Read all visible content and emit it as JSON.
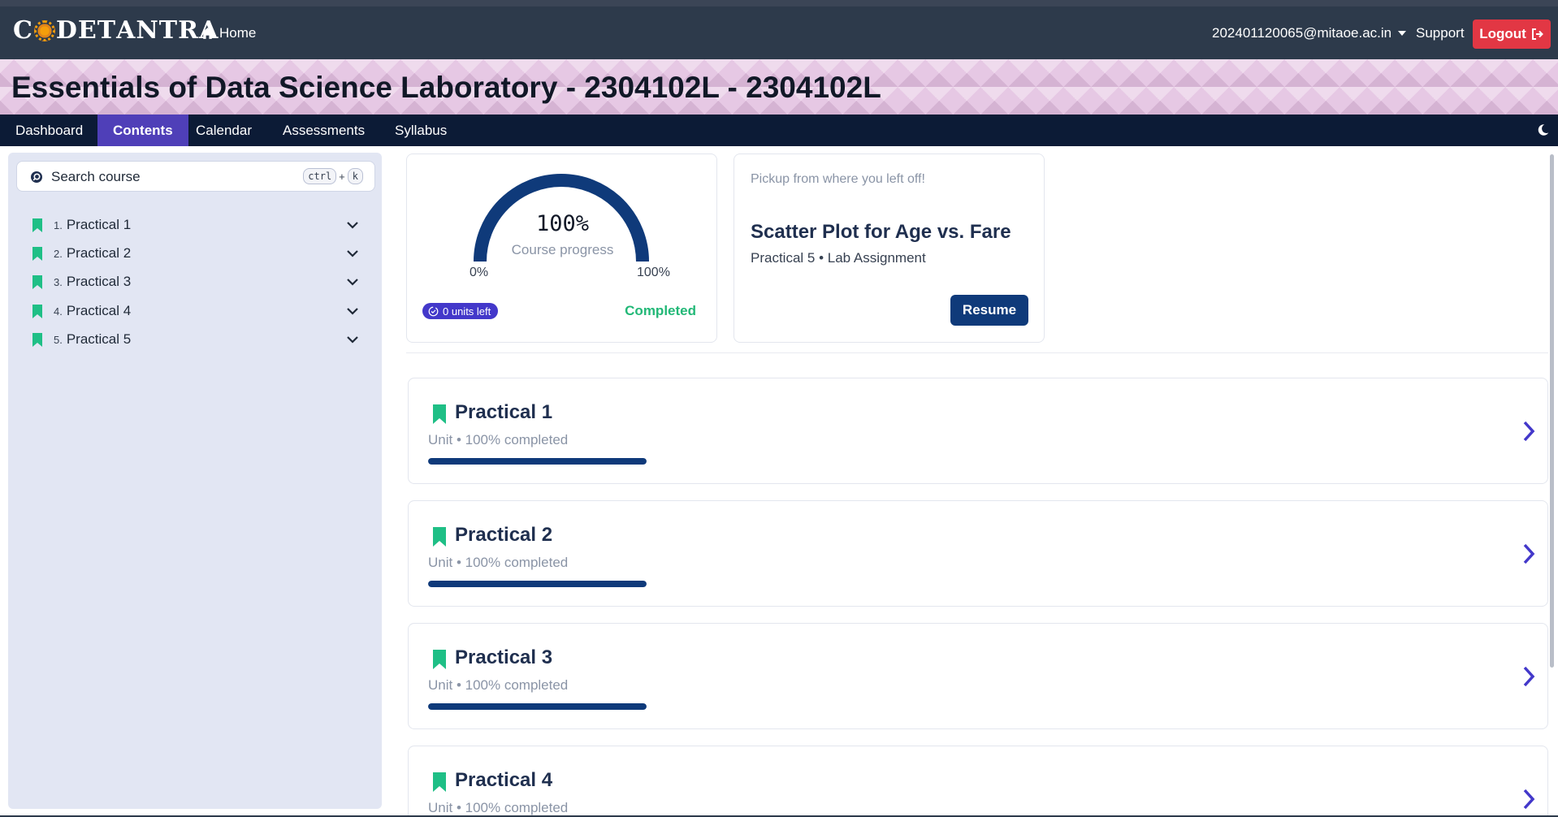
{
  "header": {
    "logo_text_a": "C",
    "logo_text_b": "DET",
    "logo_text_c": "ANTRA",
    "home_label": "Home",
    "user_email": "202401120065@mitaoe.ac.in",
    "support_label": "Support",
    "logout_label": "Logout"
  },
  "course": {
    "title": "Essentials of Data Science Laboratory - 2304102L - 2304102L"
  },
  "nav": {
    "tabs": [
      {
        "label": "Dashboard",
        "active": false
      },
      {
        "label": "Contents",
        "active": true
      },
      {
        "label": "Calendar",
        "active": false
      },
      {
        "label": "Assessments",
        "active": false
      },
      {
        "label": "Syllabus",
        "active": false
      }
    ]
  },
  "sidebar": {
    "search_label": "Search course",
    "shortcut_key1": "ctrl",
    "shortcut_plus": "+",
    "shortcut_key2": "k",
    "items": [
      {
        "num": "1.",
        "label": "Practical 1"
      },
      {
        "num": "2.",
        "label": "Practical 2"
      },
      {
        "num": "3.",
        "label": "Practical 3"
      },
      {
        "num": "4.",
        "label": "Practical 4"
      },
      {
        "num": "5.",
        "label": "Practical 5"
      }
    ]
  },
  "progress": {
    "percent_text": "100%",
    "percent_value": 100,
    "label": "Course progress",
    "min_label": "0%",
    "max_label": "100%",
    "units_left": "0 units left",
    "status": "Completed"
  },
  "resume": {
    "hint": "Pickup from where you left off!",
    "title": "Scatter Plot for Age vs. Fare",
    "subtitle": "Practical 5 • Lab Assignment",
    "button_label": "Resume"
  },
  "units": [
    {
      "title": "Practical 1",
      "subtitle": "Unit • 100% completed",
      "progress": 100
    },
    {
      "title": "Practical 2",
      "subtitle": "Unit • 100% completed",
      "progress": 100
    },
    {
      "title": "Practical 3",
      "subtitle": "Unit • 100% completed",
      "progress": 100
    },
    {
      "title": "Practical 4",
      "subtitle": "Unit • 100% completed",
      "progress": 100
    }
  ],
  "colors": {
    "accent": "#4f3fb8",
    "brand_dark": "#0f3a7a",
    "success": "#22b877",
    "bookmark": "#1fbf86",
    "danger": "#e23744"
  },
  "icons": {
    "home": "home-icon",
    "logout": "sign-out-icon",
    "theme": "moon-icon",
    "search": "search-icon",
    "bookmark": "bookmark-icon",
    "chevron_down": "chevron-down-icon",
    "chevron_right": "chevron-right-icon",
    "clock": "clock-check-icon"
  }
}
